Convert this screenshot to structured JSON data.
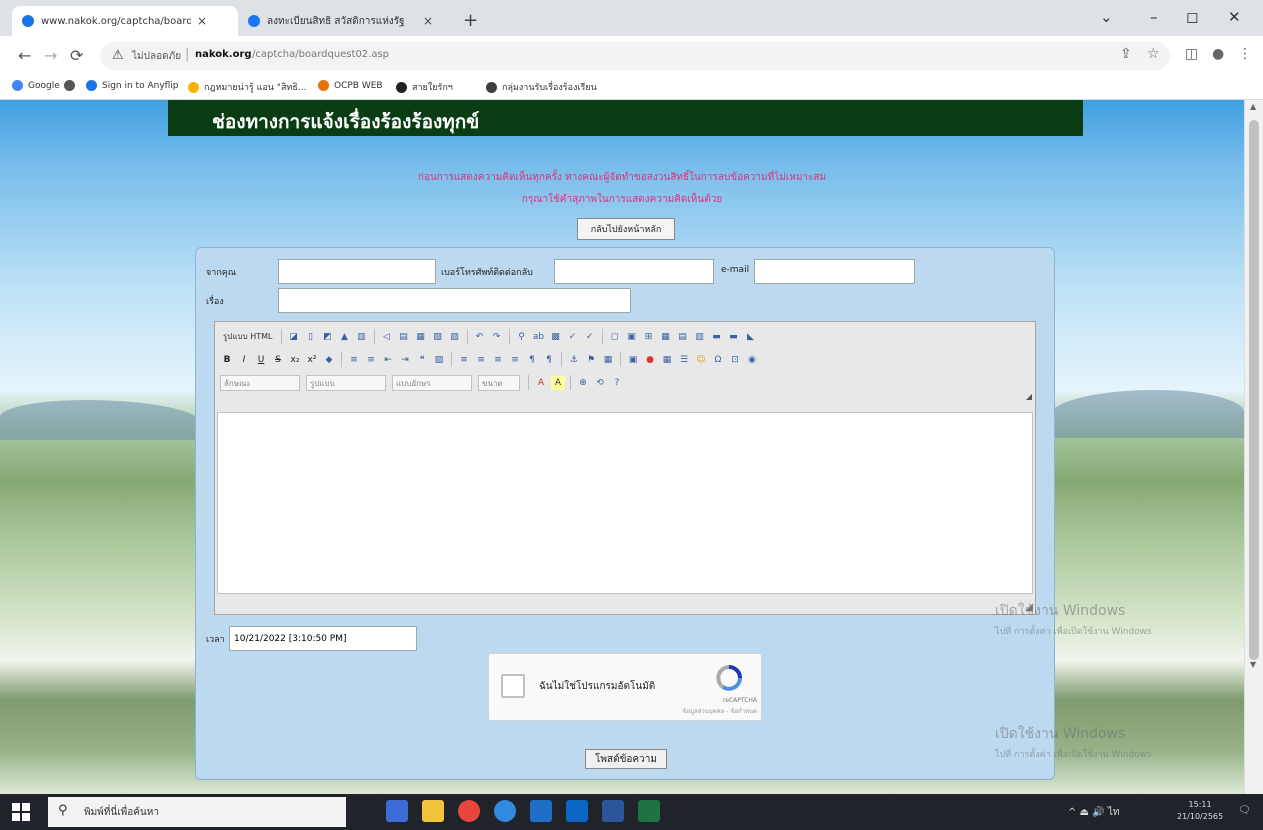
{
  "browser": {
    "tabs": [
      {
        "title": "www.nakok.org/captcha/boardq",
        "active": true
      },
      {
        "title": "ลงทะเบียนสิทธิ สวัสดิการแห่งรัฐ",
        "active": false
      }
    ],
    "tab_close": "×",
    "new_tab": "+",
    "window_controls": {
      "chevron": "⌄",
      "minimize": "–",
      "maximize": "◻",
      "close": "✕"
    },
    "nav": {
      "back": "←",
      "forward": "→",
      "reload": "⟳"
    },
    "address": {
      "warning_icon": "⚠",
      "security_label": "ไม่ปลอดภัย",
      "separator": "|",
      "host": "nakok.org",
      "path": "/captcha/boardquest02.asp"
    },
    "toolbar_icons": {
      "share": "⇪",
      "star": "☆",
      "sidepanel": "◫",
      "profile": "●",
      "menu": "⋮"
    },
    "bookmarks": [
      {
        "label": "Google",
        "color": "#4285f4"
      },
      {
        "label": "",
        "color": "#555555"
      },
      {
        "label": "Sign in to Anyflip",
        "color": "#1a73e8"
      },
      {
        "label": "กฎหมายน่ารู้ แอน \"สิทธิ...",
        "color": "#f4b400"
      },
      {
        "label": "OCPB WEB",
        "color": "#e8710a"
      },
      {
        "label": "สายใยรักฯ",
        "color": "#202124"
      },
      {
        "label": "กลุ่มงานรับเรื่องร้องเรียน",
        "color": "#3c4043"
      }
    ]
  },
  "page": {
    "header_title": "ช่องทางการแจ้งเรื่องร้องร้องทุกข์",
    "notice_line1": "ก่อนการแสดงความคิดเห็นทุกครั้ง ทางคณะผู้จัดทำขอสงวนสิทธิ์ในการลบข้อความที่ไม่เหมาะสม",
    "notice_line2": "กรุณาใช้คำสุภาพในการแสดงความคิดเห็นด้วย",
    "back_label": "กลับไปยังหน้าหลัก",
    "form": {
      "name_label": "จากคุณ",
      "name_value": "",
      "phone_label": "เบอร์โทรศัพท์ติดต่อกลับ",
      "phone_value": "",
      "email_label": "e-mail",
      "email_value": "",
      "subject_label": "เรื่อง",
      "subject_value": "",
      "time_label": "เวลา",
      "time_value": "10/21/2022 [3:10:50 PM]",
      "submit_label": "โพสต์ข้อความ"
    },
    "editor": {
      "source_label": "รูปแบบ HTML",
      "combos": [
        "ลักษณะ",
        "รูปแบบ",
        "แบบอักษร",
        "ขนาด"
      ],
      "row1": [
        "▭",
        "◪",
        "▯",
        "◩",
        "▲",
        "▥",
        "◁",
        "▤",
        "▦",
        "▧",
        "▨",
        "↶",
        "↷",
        "⚲",
        "ab",
        "▩",
        "✓",
        "✓",
        "◻",
        "▣",
        "⊞",
        "▦",
        "▤",
        "▥",
        "▬",
        "▬",
        "◣"
      ],
      "row2": [
        "B",
        "I",
        "U",
        "S",
        "x₂",
        "x²",
        "◆",
        "≡",
        "≡",
        "⇤",
        "⇥",
        "❝",
        "▨",
        "≡",
        "≡",
        "≡",
        "≡",
        "¶",
        "¶",
        "⚓",
        "⚑",
        "▦",
        "▣",
        "●",
        "▦",
        "☰",
        "☺",
        "Ω",
        "⊡",
        "◉"
      ],
      "row3_tail": [
        "A",
        "A",
        "⊕",
        "⟲",
        "?"
      ],
      "collapse": "◢",
      "resize": "◢"
    },
    "recaptcha": {
      "label": "ฉันไม่ใช่โปรแกรมอัตโนมัติ",
      "brand": "reCAPTCHA",
      "terms": "ข้อมูลส่วนบุคคล - ข้อกำหนด"
    },
    "watermark_title": "เปิดใช้งาน Windows",
    "watermark_sub": "ไปที่ การตั้งค่า เพื่อเปิดใช้งาน Windows"
  },
  "taskbar": {
    "search_icon": "⚲",
    "search_placeholder": "พิมพ์ที่นี่เพื่อค้นหา",
    "apps": [
      {
        "color": "#3d6bd6"
      },
      {
        "color": "#f2c43c"
      },
      {
        "color": "#e8453c"
      },
      {
        "color": "#2f8ae0"
      },
      {
        "color": "#1f6fc8"
      },
      {
        "color": "#0a66c2"
      },
      {
        "color": "#2b579a"
      },
      {
        "color": "#1f7244"
      }
    ],
    "tray_text": "^ ⏏ 🔊 ไท",
    "time": "15:11",
    "date": "21/10/2565",
    "notification_icon": "🗨"
  }
}
